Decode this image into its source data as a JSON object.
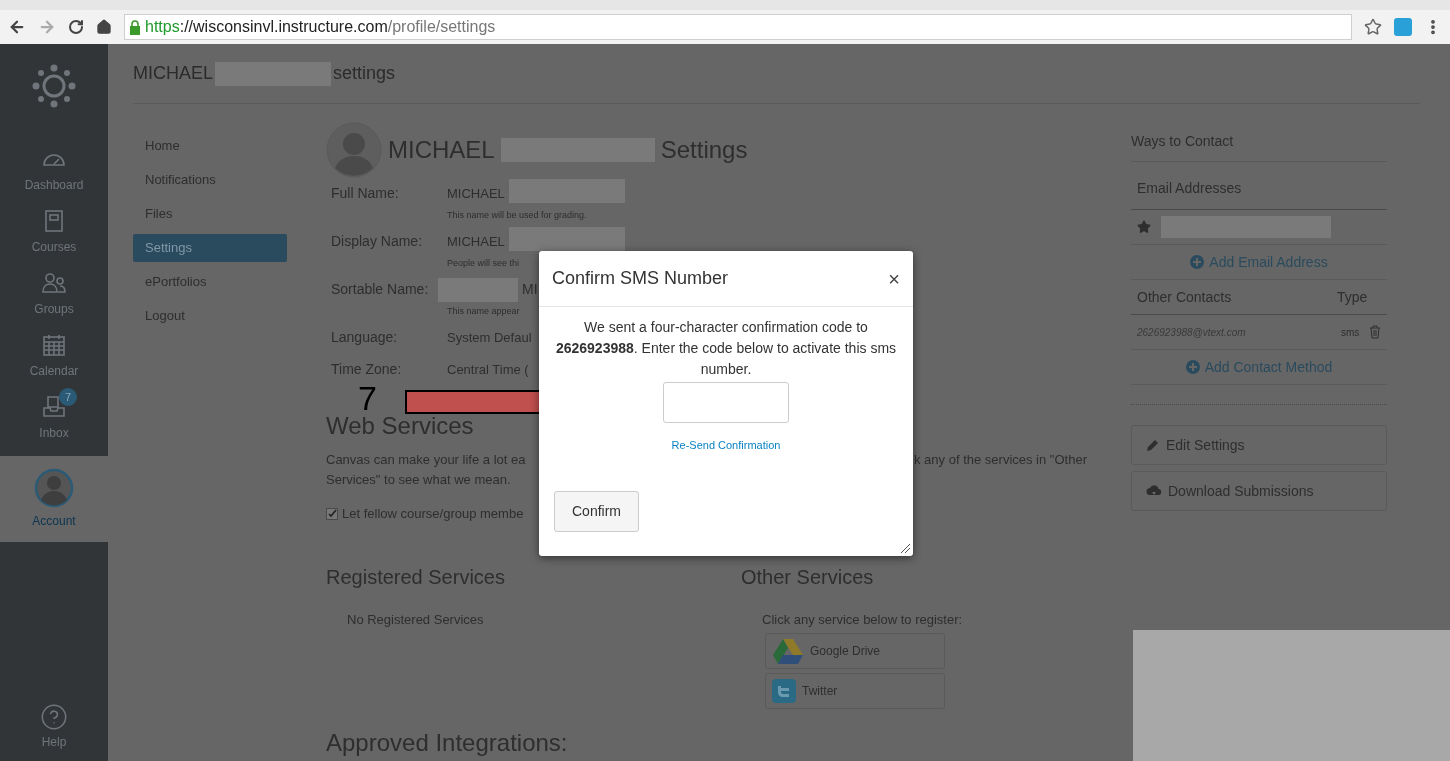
{
  "browser": {
    "scheme": "https",
    "host": "://wisconsinvl.instructure.com",
    "path": "/profile/settings"
  },
  "nav": {
    "items": [
      {
        "label": "Dashboard",
        "selected": false
      },
      {
        "label": "Courses",
        "selected": false
      },
      {
        "label": "Groups",
        "selected": false
      },
      {
        "label": "Calendar",
        "selected": false
      },
      {
        "label": "Inbox",
        "selected": false,
        "badge": "7"
      },
      {
        "label": "Account",
        "selected": true
      }
    ],
    "help": "Help"
  },
  "page_title": {
    "first": "MICHAEL",
    "rest": "settings"
  },
  "submenu": [
    {
      "label": "Home",
      "selected": false
    },
    {
      "label": "Notifications",
      "selected": false
    },
    {
      "label": "Files",
      "selected": false
    },
    {
      "label": "Settings",
      "selected": true
    },
    {
      "label": "ePortfolios",
      "selected": false
    },
    {
      "label": "Logout",
      "selected": false
    }
  ],
  "profile": {
    "name_first": "MICHAEL",
    "name_rest": "Settings",
    "fields": [
      {
        "label": "Full Name:",
        "value": "MICHAEL",
        "hint": "This name will be used for grading."
      },
      {
        "label": "Display Name:",
        "value": "MICHAEL",
        "hint": "People will see thi"
      },
      {
        "label": "Sortable Name:",
        "value": "MI",
        "hint": "This name appear"
      },
      {
        "label": "Language:",
        "value": "System Defaul"
      },
      {
        "label": "Time Zone:",
        "value": "Central Time ("
      }
    ]
  },
  "web_services": {
    "title": "Web Services",
    "text_left": "Canvas can make your life a lot ea",
    "text_right": "k any of the services in \"Other",
    "text_line2": "Services\" to see what we mean.",
    "checkbox": {
      "label": "Let fellow course/group membe",
      "checked": true
    }
  },
  "registered": {
    "title": "Registered Services",
    "empty": "No Registered Services"
  },
  "other_services": {
    "title": "Other Services",
    "hint": "Click any service below to register:",
    "services": [
      "Google Drive",
      "Twitter"
    ]
  },
  "approved_title": "Approved Integrations:",
  "contact": {
    "title": "Ways to Contact",
    "email_header": "Email Addresses",
    "add_email": "Add Email Address",
    "other_header": "Other Contacts",
    "type_header": "Type",
    "contacts": [
      {
        "address": "2626923988@vtext.com",
        "type": "sms"
      }
    ],
    "add_contact": "Add Contact Method"
  },
  "actions": [
    "Edit Settings",
    "Download Submissions"
  ],
  "dialog": {
    "title": "Confirm SMS Number",
    "close": "×",
    "message": "We sent a four-character confirmation code to **2626923988**. Enter the code below to activate this sms number.",
    "resend": "Re-Send Confirmation",
    "confirm": "Confirm"
  },
  "annotation": {
    "number": "7"
  }
}
